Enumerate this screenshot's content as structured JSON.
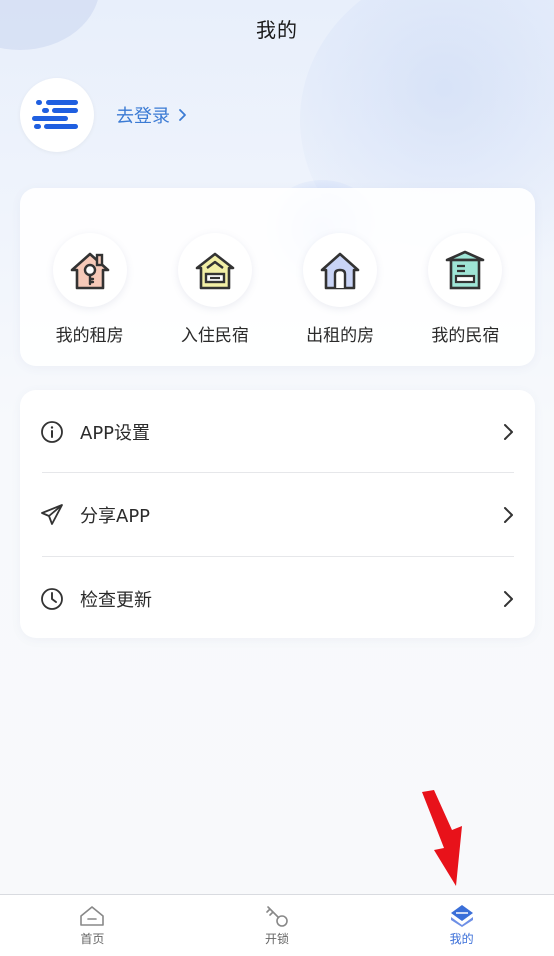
{
  "header": {
    "title": "我的"
  },
  "profile": {
    "login_label": "去登录",
    "avatar_icon": "logo-speed-lines-icon",
    "accent_color": "#3b7bd4"
  },
  "quick_actions": [
    {
      "label": "我的租房",
      "icon": "house-key-icon",
      "color": "#f6c9b8"
    },
    {
      "label": "入住民宿",
      "icon": "house-checkin-icon",
      "color": "#f2efa6"
    },
    {
      "label": "出租的房",
      "icon": "house-door-icon",
      "color": "#c9d4f6"
    },
    {
      "label": "我的民宿",
      "icon": "building-icon",
      "color": "#9fe5d6"
    }
  ],
  "menu": [
    {
      "label": "APP设置",
      "icon": "info-circle-icon"
    },
    {
      "label": "分享APP",
      "icon": "paper-plane-icon"
    },
    {
      "label": "检查更新",
      "icon": "clock-icon"
    }
  ],
  "tabbar": {
    "active": 2,
    "active_color": "#3b6fd8",
    "tabs": [
      {
        "label": "首页",
        "icon": "home-icon"
      },
      {
        "label": "开锁",
        "icon": "key-icon"
      },
      {
        "label": "我的",
        "icon": "profile-diamond-icon"
      }
    ]
  }
}
